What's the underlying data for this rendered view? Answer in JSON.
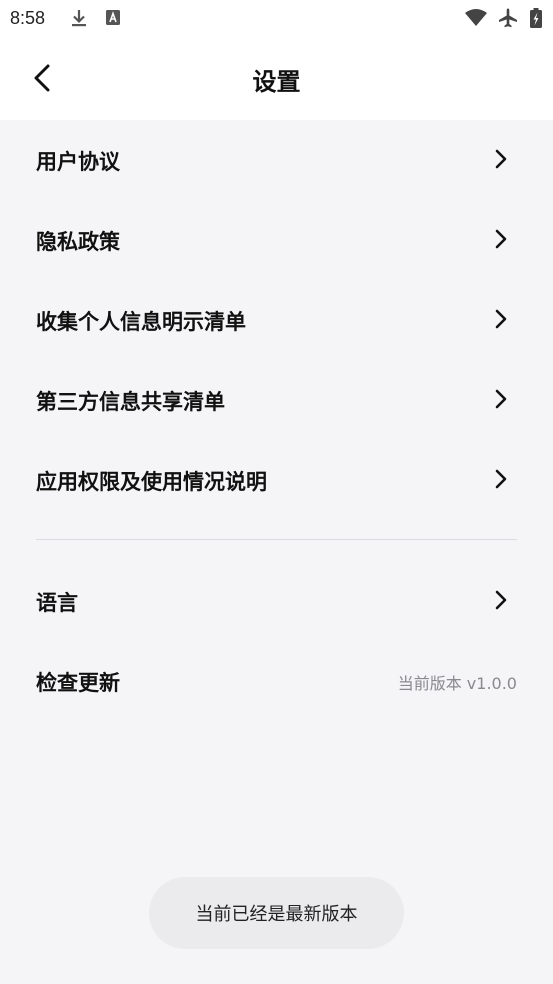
{
  "status_bar": {
    "time": "8:58",
    "icons": [
      "download-icon",
      "text-box-icon",
      "wifi-icon",
      "airplane-icon",
      "battery-charging-icon"
    ]
  },
  "header": {
    "title": "设置",
    "back_icon": "chevron-left-icon"
  },
  "menu": {
    "items": [
      {
        "label": "用户协议"
      },
      {
        "label": "隐私政策"
      },
      {
        "label": "收集个人信息明示清单"
      },
      {
        "label": "第三方信息共享清单"
      },
      {
        "label": "应用权限及使用情况说明"
      },
      {
        "label": "语言"
      },
      {
        "label": "检查更新",
        "value": "当前版本 v1.0.0"
      }
    ]
  },
  "toast": {
    "text": "当前已经是最新版本"
  },
  "colors": {
    "background": "#f5f5f8",
    "header": "#ffffff",
    "divider": "#dcdce0",
    "secondary_text": "#8a8a8e",
    "toast_bg": "#ebebee"
  }
}
